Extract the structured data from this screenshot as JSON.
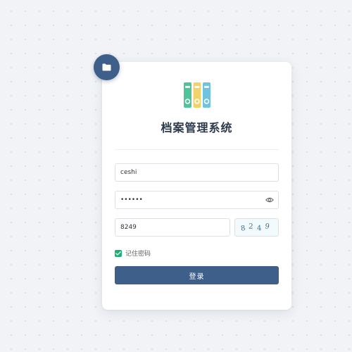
{
  "app": {
    "title": "档案管理系统"
  },
  "form": {
    "username_value": "ceshi",
    "password_value": "••••••",
    "code_value": "8249",
    "captcha_digits": [
      "8",
      "2",
      "4",
      "9"
    ],
    "remember_label": "记住密码",
    "remember_checked": true,
    "login_label": "登录"
  },
  "icons": {
    "badge": "folder-icon",
    "logo": "binders-icon",
    "password_toggle": "eye-icon",
    "checkbox": "check-icon"
  },
  "colors": {
    "primary": "#3d5f8a",
    "checkbox": "#1bae75",
    "binder_green": "#4fc39a",
    "binder_yellow": "#f2d36b",
    "binder_blue": "#6fc3df"
  }
}
